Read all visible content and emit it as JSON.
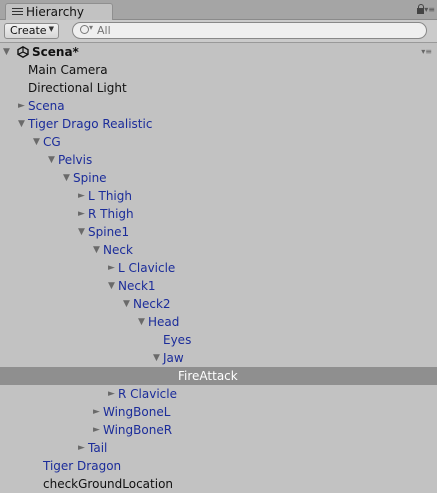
{
  "panel": {
    "tab_label": "Hierarchy"
  },
  "toolbar": {
    "create_label": "Create",
    "search_placeholder": "All"
  },
  "scene": {
    "name": "Scena*"
  },
  "tree": [
    {
      "label": "Main Camera",
      "arrow": "",
      "color": "black"
    },
    {
      "label": "Directional Light",
      "arrow": "",
      "color": "black"
    },
    {
      "label": "Scena",
      "arrow": "►",
      "color": "blue"
    },
    {
      "label": "Tiger Drago Realistic",
      "arrow": "▼",
      "color": "blue"
    },
    {
      "label": "CG",
      "arrow": "▼",
      "color": "blue"
    },
    {
      "label": "Pelvis",
      "arrow": "▼",
      "color": "blue"
    },
    {
      "label": "Spine",
      "arrow": "▼",
      "color": "blue"
    },
    {
      "label": "L Thigh",
      "arrow": "►",
      "color": "blue"
    },
    {
      "label": "R Thigh",
      "arrow": "►",
      "color": "blue"
    },
    {
      "label": "Spine1",
      "arrow": "▼",
      "color": "blue"
    },
    {
      "label": "Neck",
      "arrow": "▼",
      "color": "blue"
    },
    {
      "label": "L Clavicle",
      "arrow": "►",
      "color": "blue"
    },
    {
      "label": "Neck1",
      "arrow": "▼",
      "color": "blue"
    },
    {
      "label": "Neck2",
      "arrow": "▼",
      "color": "blue"
    },
    {
      "label": "Head",
      "arrow": "▼",
      "color": "blue"
    },
    {
      "label": "Eyes",
      "arrow": "",
      "color": "blue"
    },
    {
      "label": "Jaw",
      "arrow": "▼",
      "color": "blue"
    },
    {
      "label": "FireAttack",
      "arrow": "",
      "color": "white",
      "selected": true
    },
    {
      "label": "R Clavicle",
      "arrow": "►",
      "color": "blue"
    },
    {
      "label": "WingBoneL",
      "arrow": "►",
      "color": "blue"
    },
    {
      "label": "WingBoneR",
      "arrow": "►",
      "color": "blue"
    },
    {
      "label": "Tail",
      "arrow": "►",
      "color": "blue"
    },
    {
      "label": "Tiger Dragon",
      "arrow": "",
      "color": "blue"
    },
    {
      "label": "checkGroundLocation",
      "arrow": "",
      "color": "black"
    }
  ]
}
